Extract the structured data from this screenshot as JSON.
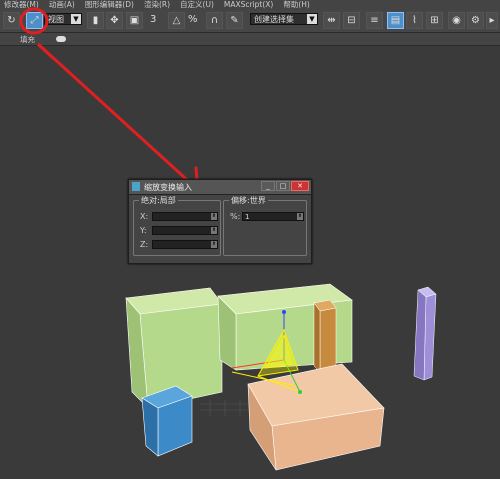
{
  "menu": [
    "修改器(M)",
    "动画(A)",
    "图形编辑器(D)",
    "渲染(R)",
    "自定义(U)",
    "MAXScript(X)",
    "帮助(H)"
  ],
  "toolbar": {
    "undo_icon": "undo-icon",
    "percent_label": "%",
    "snap_label": "3",
    "dropdown_left": "视图",
    "dropdown_selection": "创建选择集"
  },
  "ribbon": {
    "label": "填充"
  },
  "dialog": {
    "title": "缩放变换输入",
    "left_group": {
      "title": "绝对:局部",
      "rows": [
        {
          "label": "X:",
          "value": ""
        },
        {
          "label": "Y:",
          "value": ""
        },
        {
          "label": "Z:",
          "value": ""
        }
      ]
    },
    "right_group": {
      "title": "偏移:世界",
      "rows": [
        {
          "label": "%:",
          "value": "1"
        }
      ]
    }
  },
  "colors": {
    "green_box": "#b5d98a",
    "orange_pillar": "#c58a3e",
    "purple_pillar": "#9f8fd8",
    "blue_box": "#3c8bc8",
    "salmon_box": "#e8b58e",
    "annotation_red": "#e02020"
  }
}
